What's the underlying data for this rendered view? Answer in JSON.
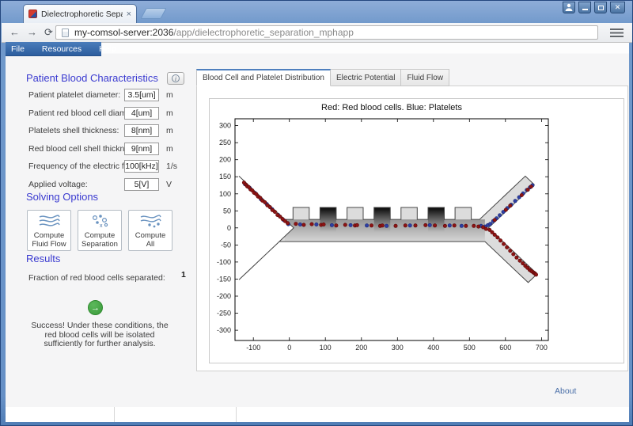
{
  "browser": {
    "tab_title": "Dielectrophoretic Separati",
    "url_host": "my-comsol-server:2036",
    "url_path": "/app/dielectrophoretic_separation_mphapp",
    "back_glyph": "←",
    "forward_glyph": "→",
    "reload_glyph": "⟳",
    "close_glyph": "✕",
    "tab_close_glyph": "×"
  },
  "menu": {
    "items": [
      "File",
      "Resources",
      "Help"
    ]
  },
  "sidebar": {
    "section1_title": "Patient Blood Characteristics",
    "fields": [
      {
        "label": "Patient platelet diameter:",
        "value": "3.5[um]",
        "unit": "m"
      },
      {
        "label": "Patient red blood cell diameter:",
        "value": "4[um]",
        "unit": "m"
      },
      {
        "label": "Platelets shell thickness:",
        "value": "8[nm]",
        "unit": "m"
      },
      {
        "label": "Red blood cell shell thickness:",
        "value": "9[nm]",
        "unit": "m"
      },
      {
        "label": "Frequency of the electric field:",
        "value": "100[kHz]",
        "unit": "1/s"
      },
      {
        "label": "Applied voltage:",
        "value": "5[V]",
        "unit": "V"
      }
    ],
    "section2_title": "Solving Options",
    "buttons": [
      {
        "line1": "Compute",
        "line2": "Fluid Flow"
      },
      {
        "line1": "Compute",
        "line2": "Separation"
      },
      {
        "line1": "Compute",
        "line2": "All"
      }
    ],
    "section3_title": "Results",
    "result_label": "Fraction of red blood cells separated:",
    "result_value": "1",
    "go_glyph": "→",
    "success_lines": [
      "Success! Under these conditions, the",
      "red blood cells will be isolated",
      "sufficiently for further analysis."
    ]
  },
  "tabs": {
    "items": [
      "Blood Cell and Platelet Distribution",
      "Electric Potential",
      "Fluid Flow"
    ]
  },
  "footer": {
    "about_label": "About"
  },
  "colors": {
    "heading_blue": "#3a3ad0",
    "menu_bar_blue": "#3a6db3",
    "success_green": "#3a9a3a",
    "red_cells": "#8d1414",
    "platelets": "#2e3fa3"
  },
  "chart_data": {
    "type": "scatter",
    "title": "Red: Red blood cells. Blue: Platelets",
    "xlim": [
      -151,
      719
    ],
    "ylim": [
      -330,
      320
    ],
    "xticks": [
      -100,
      0,
      100,
      200,
      300,
      400,
      500,
      600,
      700
    ],
    "yticks": [
      -300,
      -250,
      -200,
      -150,
      -100,
      -50,
      0,
      50,
      100,
      150,
      200,
      250,
      300
    ],
    "grid": false,
    "legend": "none (encoded in title)",
    "series": [
      {
        "name": "Red blood cells",
        "color": "#8d1414",
        "edge": "#5c0909",
        "points": [
          [
            -126,
            133
          ],
          [
            -121,
            127
          ],
          [
            -117,
            122
          ],
          [
            -113,
            120
          ],
          [
            -108,
            113
          ],
          [
            -103,
            110
          ],
          [
            -98,
            103
          ],
          [
            -92,
            99
          ],
          [
            -87,
            92
          ],
          [
            -81,
            88
          ],
          [
            -75,
            80
          ],
          [
            -68,
            75
          ],
          [
            -61,
            66
          ],
          [
            -54,
            61
          ],
          [
            -47,
            52
          ],
          [
            -40,
            47
          ],
          [
            -33,
            38
          ],
          [
            -26,
            33
          ],
          [
            -19,
            26
          ],
          [
            -12,
            20
          ],
          [
            -5,
            14
          ],
          [
            18,
            12
          ],
          [
            40,
            9
          ],
          [
            62,
            11
          ],
          [
            88,
            9
          ],
          [
            95,
            10
          ],
          [
            130,
            7
          ],
          [
            155,
            9
          ],
          [
            182,
            7
          ],
          [
            188,
            8
          ],
          [
            228,
            7
          ],
          [
            252,
            6
          ],
          [
            258,
            7
          ],
          [
            295,
            6
          ],
          [
            322,
            7
          ],
          [
            350,
            7
          ],
          [
            378,
            8
          ],
          [
            404,
            7
          ],
          [
            432,
            6
          ],
          [
            458,
            7
          ],
          [
            490,
            6
          ],
          [
            512,
            6
          ],
          [
            525,
            4
          ],
          [
            538,
            2
          ],
          [
            546,
            -3
          ],
          [
            570,
            23
          ],
          [
            601,
            53
          ],
          [
            613,
            65
          ],
          [
            645,
            96
          ],
          [
            662,
            112
          ],
          [
            671,
            121
          ],
          [
            556,
            -6
          ],
          [
            563,
            -13
          ],
          [
            570,
            -20
          ],
          [
            578,
            -28
          ],
          [
            586,
            -37
          ],
          [
            595,
            -47
          ],
          [
            604,
            -57
          ],
          [
            613,
            -67
          ],
          [
            622,
            -77
          ],
          [
            631,
            -87
          ],
          [
            640,
            -96
          ],
          [
            648,
            -104
          ],
          [
            655,
            -111
          ],
          [
            661,
            -117
          ],
          [
            667,
            -123
          ],
          [
            671,
            -126
          ],
          [
            674,
            -128
          ],
          [
            678,
            -131
          ],
          [
            681,
            -133
          ],
          [
            683,
            -135
          ],
          [
            685,
            -137
          ]
        ]
      },
      {
        "name": "Platelets",
        "color": "#2e3fa3",
        "edge": "#1b2a78",
        "points": [
          [
            -123,
            128
          ],
          [
            -110,
            117
          ],
          [
            -95,
            102
          ],
          [
            -79,
            84
          ],
          [
            -63,
            70
          ],
          [
            -48,
            55
          ],
          [
            -31,
            38
          ],
          [
            -16,
            23
          ],
          [
            -3,
            11
          ],
          [
            30,
            10
          ],
          [
            75,
            10
          ],
          [
            118,
            8
          ],
          [
            170,
            8
          ],
          [
            215,
            7
          ],
          [
            270,
            6
          ],
          [
            335,
            7
          ],
          [
            390,
            8
          ],
          [
            445,
            7
          ],
          [
            478,
            6
          ],
          [
            532,
            6
          ],
          [
            543,
            4
          ],
          [
            551,
            8
          ],
          [
            558,
            12
          ],
          [
            566,
            20
          ],
          [
            575,
            28
          ],
          [
            584,
            37
          ],
          [
            594,
            47
          ],
          [
            605,
            58
          ],
          [
            616,
            68
          ],
          [
            627,
            79
          ],
          [
            638,
            90
          ],
          [
            649,
            101
          ],
          [
            659,
            111
          ],
          [
            668,
            119
          ],
          [
            675,
            125
          ]
        ]
      }
    ],
    "geometry": {
      "description": "Microfluidic separation channel: two inlets (upper/lower left), castellated electrode main channel, two outlets (upper/lower right)",
      "outline": [
        [
          -140,
          152
        ],
        [
          -13,
          25
        ],
        [
          10,
          25
        ],
        [
          10,
          60
        ],
        [
          55,
          60
        ],
        [
          55,
          25
        ],
        [
          85,
          25
        ],
        [
          85,
          60
        ],
        [
          130,
          60
        ],
        [
          130,
          25
        ],
        [
          160,
          25
        ],
        [
          160,
          60
        ],
        [
          205,
          60
        ],
        [
          205,
          25
        ],
        [
          235,
          25
        ],
        [
          235,
          60
        ],
        [
          280,
          60
        ],
        [
          280,
          25
        ],
        [
          310,
          25
        ],
        [
          310,
          60
        ],
        [
          355,
          60
        ],
        [
          355,
          25
        ],
        [
          385,
          25
        ],
        [
          385,
          60
        ],
        [
          430,
          60
        ],
        [
          430,
          25
        ],
        [
          460,
          25
        ],
        [
          460,
          60
        ],
        [
          505,
          60
        ],
        [
          505,
          25
        ],
        [
          528,
          25
        ],
        [
          655,
          152
        ],
        [
          680,
          127
        ],
        [
          553,
          0
        ],
        [
          688,
          -135
        ],
        [
          663,
          -160
        ],
        [
          543,
          -40
        ],
        [
          -28,
          -40
        ],
        [
          -140,
          -152
        ],
        [
          -115,
          -127
        ],
        [
          0,
          -12
        ],
        [
          12,
          0
        ],
        [
          0,
          12
        ],
        [
          -115,
          127
        ]
      ],
      "shade_rect": [
        -13,
        -40,
        543,
        25
      ],
      "teeth_span": [
        25,
        60
      ],
      "dark_teeth": [
        [
          85,
          130
        ],
        [
          235,
          280
        ],
        [
          385,
          430
        ]
      ]
    }
  }
}
